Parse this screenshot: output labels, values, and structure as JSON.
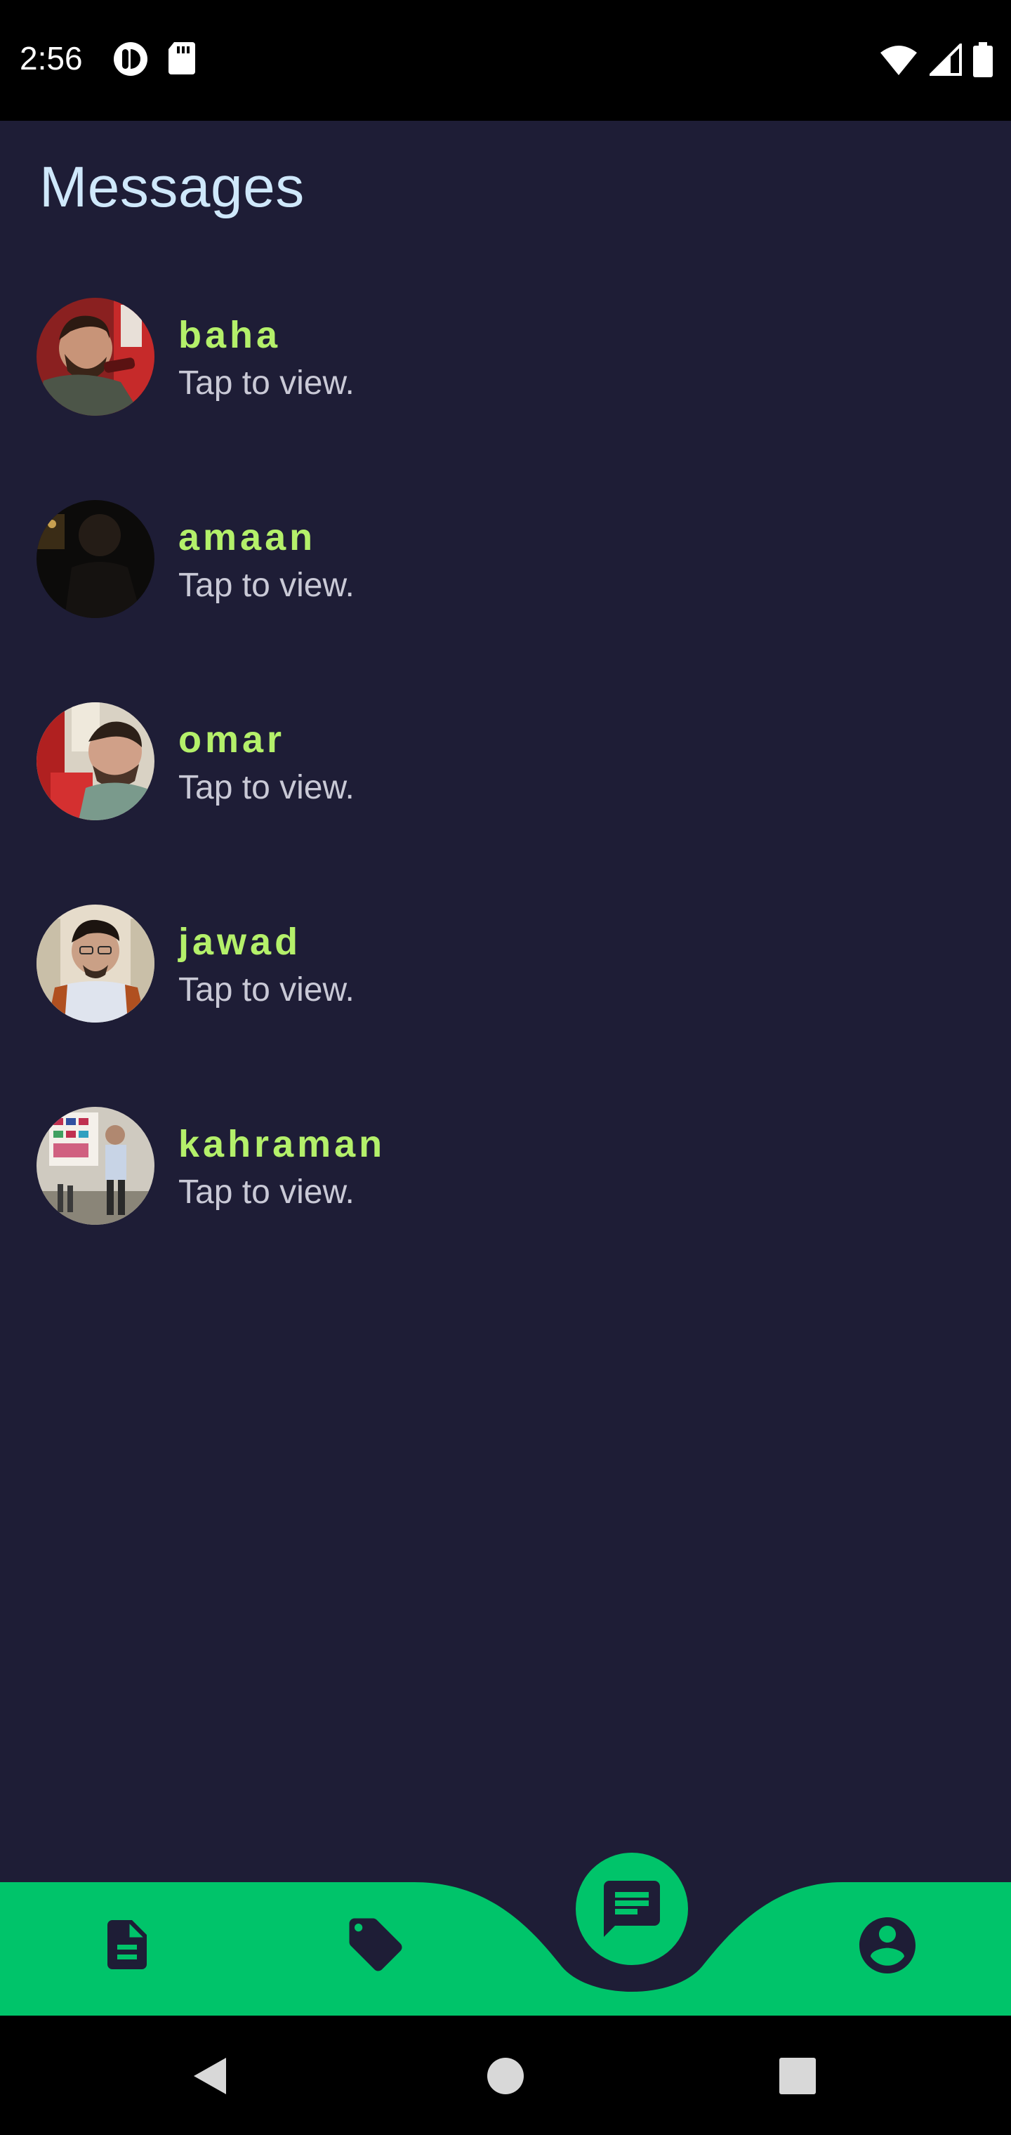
{
  "status": {
    "time": "2:56"
  },
  "title": "Messages",
  "messages": [
    {
      "name": "baha",
      "subtitle": "Tap to view."
    },
    {
      "name": "amaan",
      "subtitle": "Tap to view."
    },
    {
      "name": "omar",
      "subtitle": "Tap to view."
    },
    {
      "name": "jawad",
      "subtitle": "Tap to view."
    },
    {
      "name": "kahraman",
      "subtitle": "Tap to view."
    }
  ],
  "nav": {
    "items": [
      "document-icon",
      "tag-icon",
      "chat-icon",
      "profile-icon"
    ],
    "active": "chat-icon"
  },
  "colors": {
    "background": "#1e1d36",
    "accent": "#00c46a",
    "name": "#b4f06a",
    "title": "#cfe8fb"
  }
}
